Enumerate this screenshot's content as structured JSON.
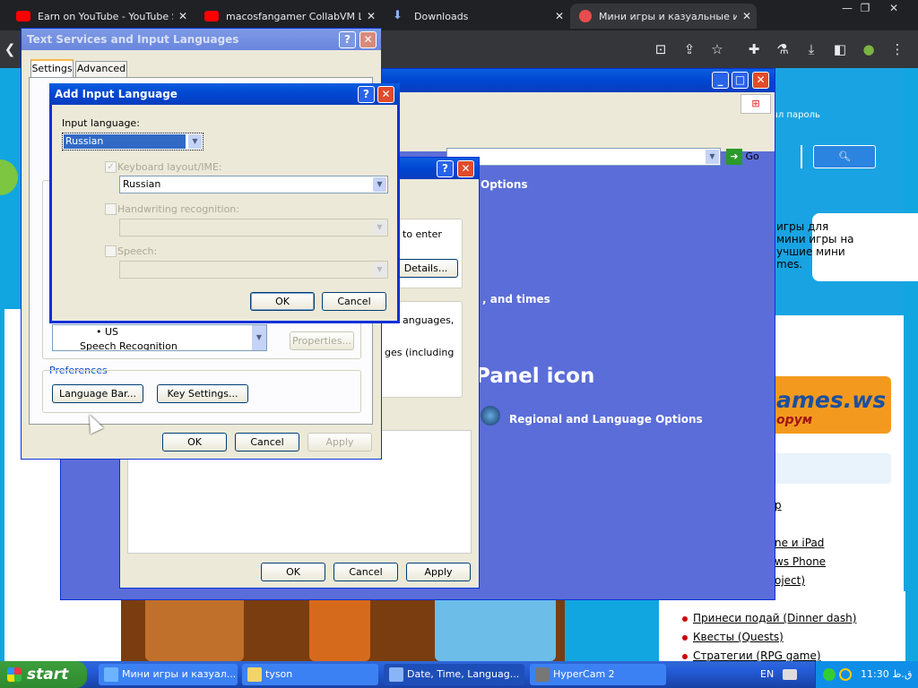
{
  "chrome": {
    "tabs": [
      {
        "title": "Earn on YouTube - YouTube S",
        "icon_color": "#ff0000"
      },
      {
        "title": "macosfangamer CollabVM Liv",
        "icon_color": "#ff0000"
      },
      {
        "title": "Downloads",
        "icon_color": "#8ab4f8"
      },
      {
        "title": "Мини игры и казуальные и",
        "icon_color": "#e84c4c"
      }
    ],
    "tab_close": "✕",
    "window_controls": [
      "—",
      "❐",
      "✕"
    ]
  },
  "website": {
    "password_hint": "ыл пароль",
    "texts": [
      "игры для",
      "мини игры на",
      "учшие мини",
      "mes."
    ],
    "banner": "ames.ws",
    "banner_sub": "орум",
    "links_partial": [
      "p",
      "ne и iPad",
      "ws Phone",
      "oject)"
    ],
    "links": [
      "Принеси подай (Dinner dash)",
      "Квесты (Quests)",
      "Стратегии (RPG game)"
    ]
  },
  "control_panel": {
    "go_label": "Go",
    "options_label": "Options",
    "times_label": ", and times",
    "panel_icon_label": "Panel icon",
    "regional_label": "Regional and Language Options"
  },
  "regional_window": {
    "enter_text": "to enter",
    "details_label": "Details...",
    "languages_text": "anguages,",
    "including_text": "ges (including",
    "ok": "OK",
    "cancel": "Cancel",
    "apply": "Apply"
  },
  "text_services": {
    "title": "Text Services and Input Languages",
    "tabs": [
      "Settings",
      "Advanced"
    ],
    "tree_item": "US",
    "tree_item2": "Speech Recognition",
    "properties_label": "Properties...",
    "preferences_label": "Preferences",
    "language_bar_label": "Language Bar...",
    "key_settings_label": "Key Settings...",
    "ok": "OK",
    "cancel": "Cancel",
    "apply": "Apply"
  },
  "add_input_language": {
    "title": "Add Input Language",
    "input_language_label": "Input language:",
    "input_language_value": "Russian",
    "keyboard_label": "Keyboard layout/IME:",
    "keyboard_value": "Russian",
    "handwriting_label": "Handwriting recognition:",
    "speech_label": "Speech:",
    "ok": "OK",
    "cancel": "Cancel"
  },
  "taskbar": {
    "start_label": "start",
    "buttons": [
      "Мини игры и казуал...",
      "tyson",
      "Date, Time, Languag...",
      "HyperCam 2"
    ],
    "lang": "EN",
    "clock": "11:30 ق.ظ"
  }
}
